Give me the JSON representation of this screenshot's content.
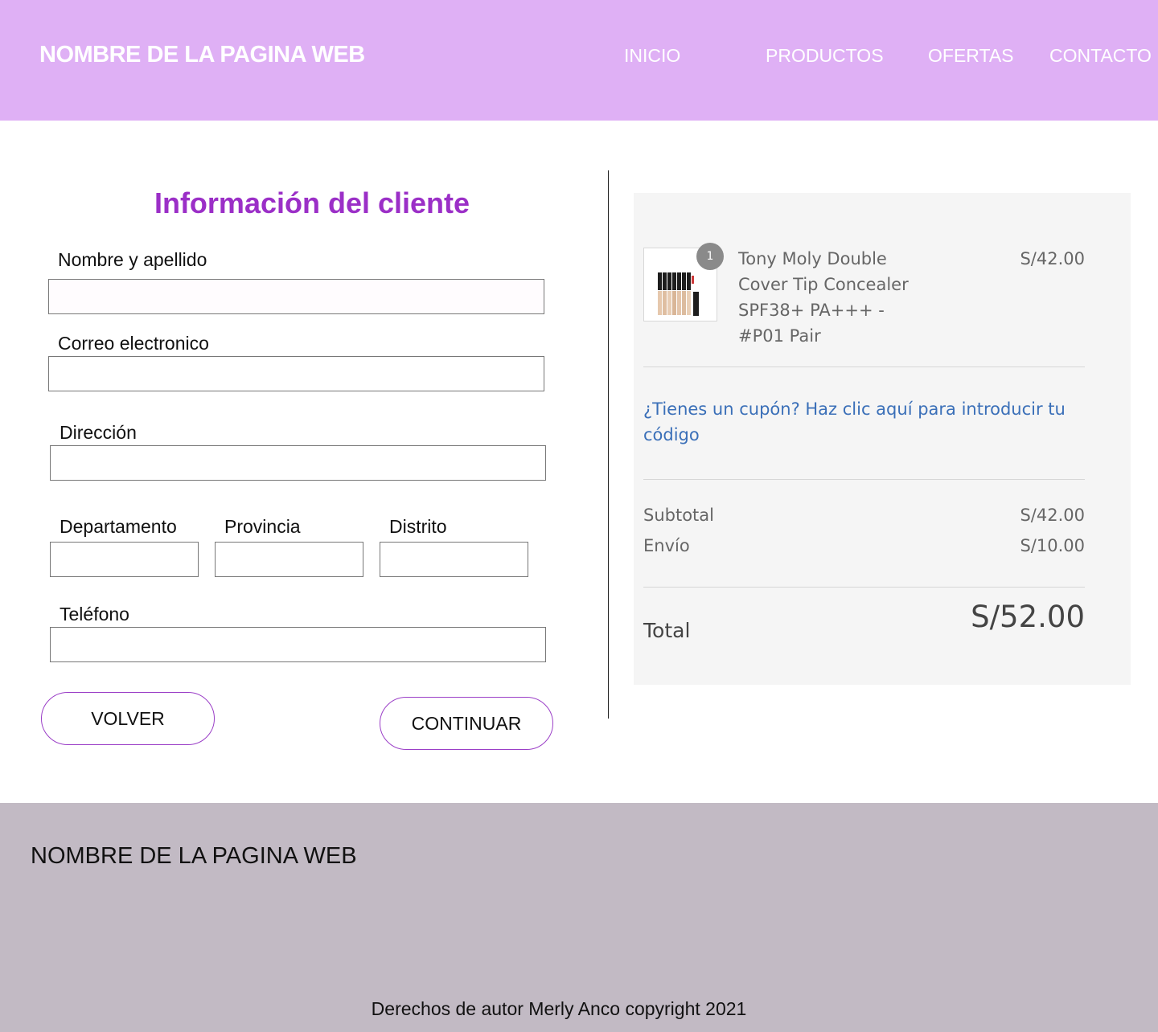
{
  "header": {
    "brand": "NOMBRE DE LA PAGINA WEB",
    "nav": {
      "inicio": "INICIO",
      "productos": "PRODUCTOS",
      "ofertas": "OFERTAS",
      "contacto": "CONTACTO"
    }
  },
  "form": {
    "title": "Información del cliente",
    "fields": {
      "nombre": {
        "label": "Nombre y apellido",
        "value": ""
      },
      "correo": {
        "label": "Correo electronico",
        "value": ""
      },
      "direccion": {
        "label": "Dirección",
        "value": ""
      },
      "departamento": {
        "label": "Departamento",
        "value": ""
      },
      "provincia": {
        "label": "Provincia",
        "value": ""
      },
      "distrito": {
        "label": "Distrito",
        "value": ""
      },
      "telefono": {
        "label": "Teléfono",
        "value": ""
      }
    },
    "buttons": {
      "back": "VOLVER",
      "continue": "CONTINUAR"
    }
  },
  "summary": {
    "item": {
      "quantity": "1",
      "name": "Tony Moly Double Cover Tip Concealer SPF38+ PA+++ - #P01 Pair",
      "price": "S/42.00"
    },
    "coupon_link": "¿Tienes un cupón? Haz clic aquí para introducir tu código",
    "subtotal_label": "Subtotal",
    "subtotal_value": "S/42.00",
    "shipping_label": "Envío",
    "shipping_value": "S/10.00",
    "total_label": "Total",
    "total_value": "S/52.00"
  },
  "footer": {
    "brand": "NOMBRE DE LA PAGINA WEB",
    "copyright": "Derechos de autor Merly Anco copyright 2021"
  },
  "colors": {
    "header_bg": "#dfb0f5",
    "title_purple": "#9b2fc7",
    "button_border": "#9b3fc7",
    "link_blue": "#3a6fb8",
    "summary_bg": "#f5f5f5",
    "footer_bg": "#c2bac4"
  }
}
